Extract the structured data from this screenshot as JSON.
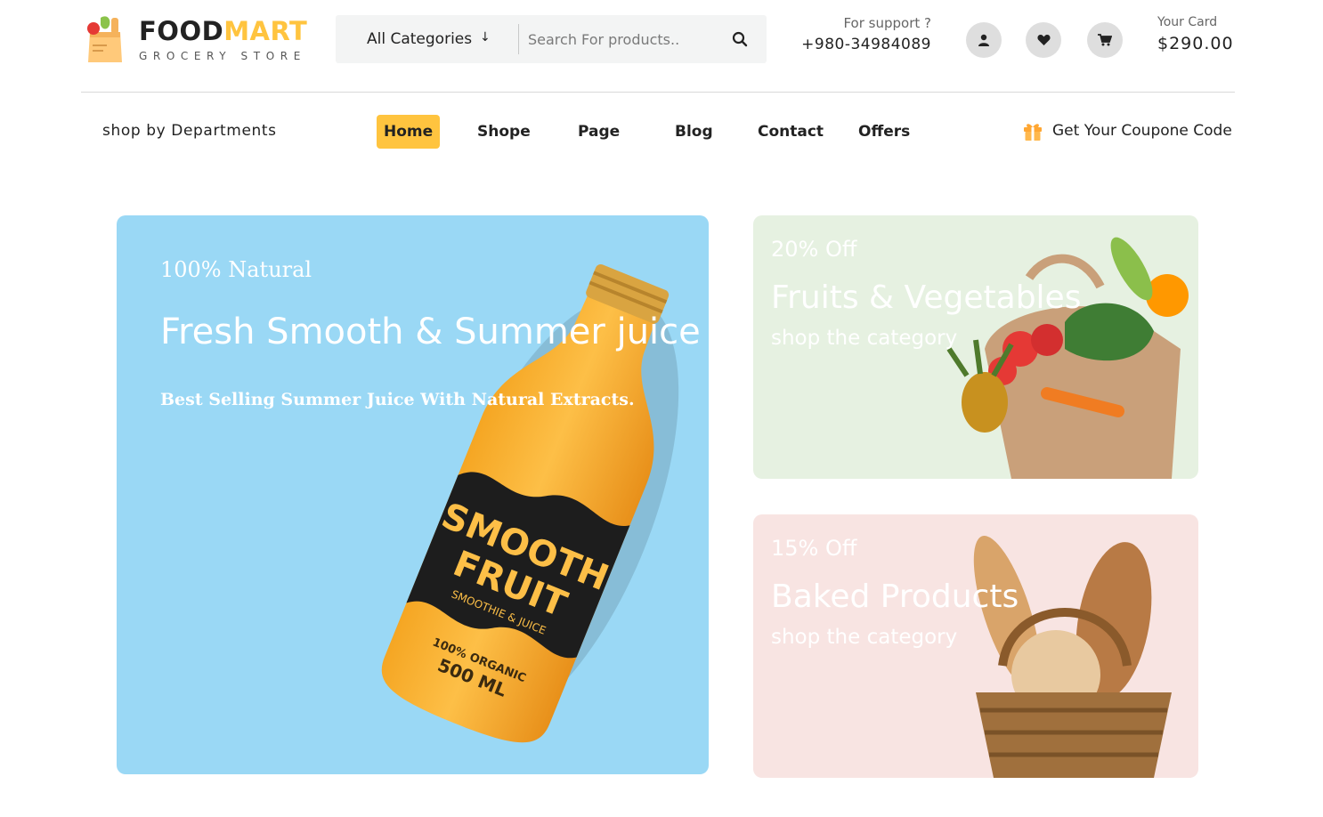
{
  "logo": {
    "word1": "FOOD",
    "word2": "MART",
    "tagline": "GROCERY STORE"
  },
  "search": {
    "category": "All Categories",
    "placeholder": "Search For products.."
  },
  "support": {
    "label": "For support ?",
    "phone": "+980-34984089"
  },
  "cart": {
    "label": "Your Card",
    "amount": "$290.00"
  },
  "nav": {
    "departments": "shop by Departments",
    "items": [
      {
        "label": "Home",
        "active": true
      },
      {
        "label": "Shope"
      },
      {
        "label": "Page"
      },
      {
        "label": "Blog"
      },
      {
        "label": "Contact"
      },
      {
        "label": "Offers"
      }
    ],
    "coupon": "Get Your Coupone Code"
  },
  "hero": {
    "eyebrow": "100% Natural",
    "title": "Fresh Smooth & Summer juice",
    "description": "Best Selling Summer Juice With Natural Extracts."
  },
  "promos": [
    {
      "discount": "20% Off",
      "title": "Fruits & Vegetables",
      "link": "shop the category"
    },
    {
      "discount": "15% Off",
      "title": "Baked Products",
      "link": "shop the category"
    }
  ],
  "colors": {
    "accent": "#FFC43F",
    "hero_bg": "#9ad8f5",
    "fruits_bg": "#e6f1e1",
    "baked_bg": "#f8e4e2"
  },
  "icons": [
    "search-icon",
    "user-icon",
    "heart-icon",
    "cart-icon",
    "gift-icon",
    "arrow-down-icon"
  ]
}
